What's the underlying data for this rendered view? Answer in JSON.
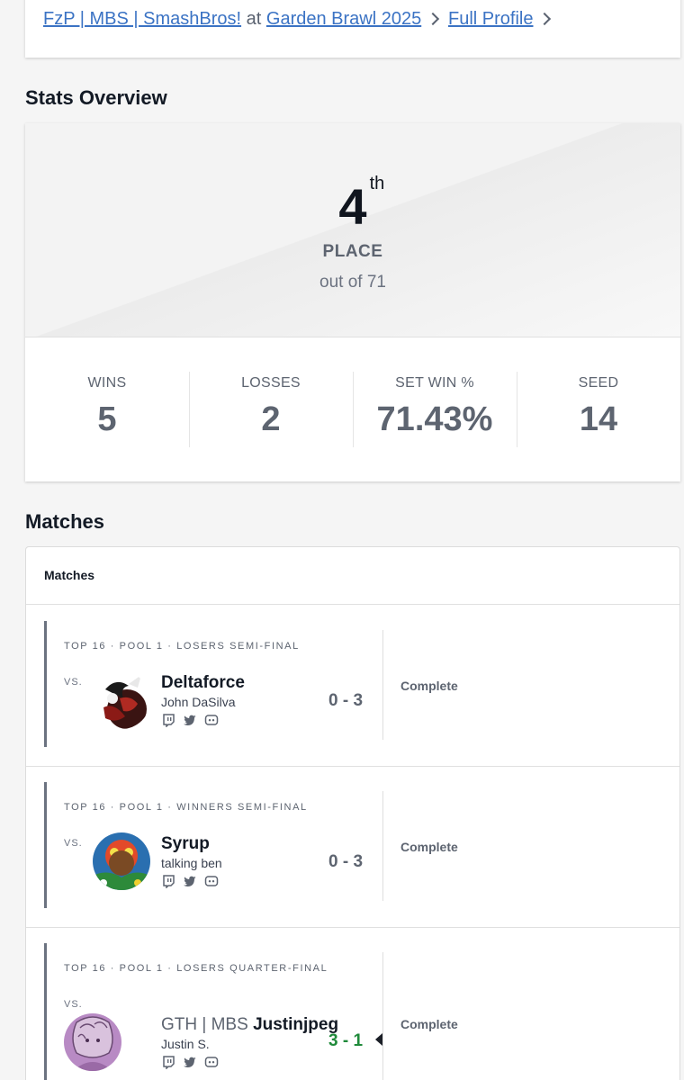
{
  "header": {
    "player_link": "FzP | MBS | SmashBros!",
    "at_text": "at",
    "event_link": "Garden Brawl 2025",
    "profile_link": "Full Profile"
  },
  "stats": {
    "title": "Stats Overview",
    "place_number": "4",
    "place_suffix": "th",
    "place_label": "PLACE",
    "place_out_of": "out of 71",
    "items": [
      {
        "label": "WINS",
        "value": "5"
      },
      {
        "label": "LOSSES",
        "value": "2"
      },
      {
        "label": "SET WIN %",
        "value": "71.43%"
      },
      {
        "label": "SEED",
        "value": "14"
      }
    ]
  },
  "matches": {
    "title": "Matches",
    "card_title": "Matches",
    "list": [
      {
        "round": "TOP 16 · POOL 1 · LOSERS SEMI-FINAL",
        "vs": "VS.",
        "prefix": "",
        "name": "Deltaforce",
        "real_name": "John DaSilva",
        "score": "0 - 3",
        "status": "Complete"
      },
      {
        "round": "TOP 16 · POOL 1 · WINNERS SEMI-FINAL",
        "vs": "VS.",
        "prefix": "",
        "name": "Syrup",
        "real_name": "talking ben",
        "score": "0 - 3",
        "status": "Complete"
      },
      {
        "round": "TOP 16 · POOL 1 · LOSERS QUARTER-FINAL",
        "vs": "VS.",
        "prefix": "GTH | MBS",
        "name": "Justinjpeg",
        "real_name": "Justin S.",
        "score": "3 - 1",
        "status": "Complete"
      }
    ]
  },
  "colors": {
    "link": "#3b73c4",
    "win_score": "#1f8a3a",
    "muted": "#5d6470"
  },
  "icons": [
    "chevron-right-icon",
    "twitch-icon",
    "twitter-icon",
    "discord-icon"
  ]
}
